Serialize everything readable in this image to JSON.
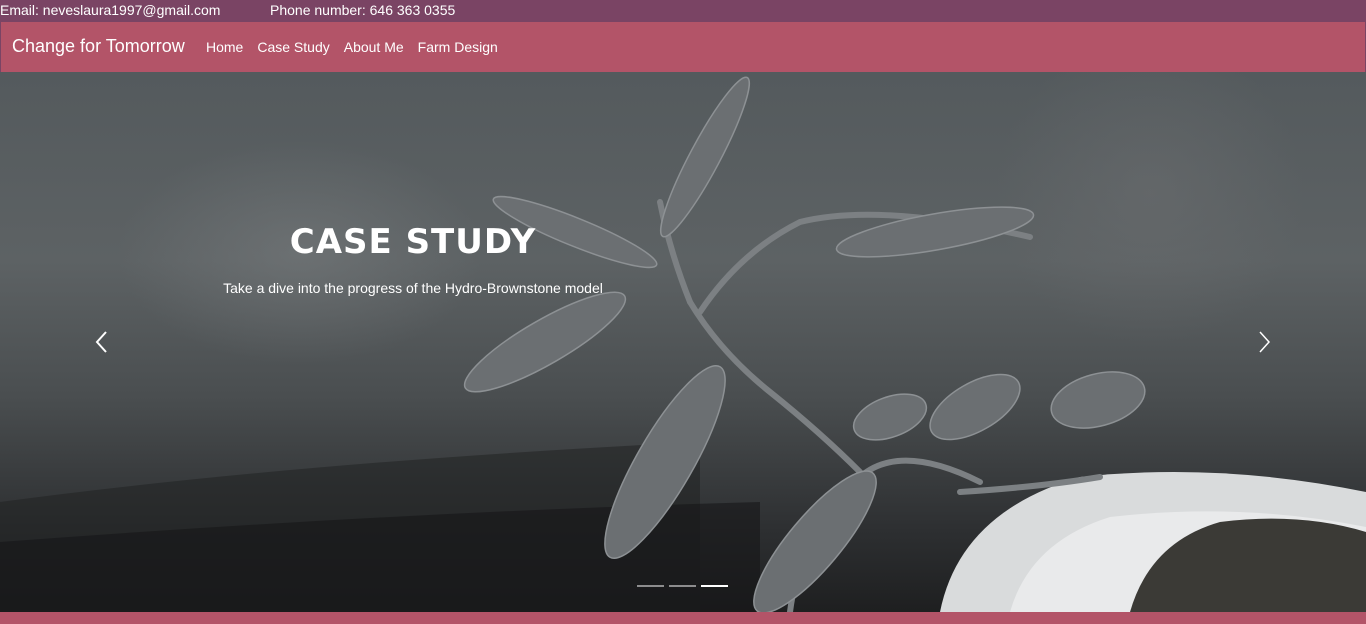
{
  "topbar": {
    "email": "Email: neveslaura1997@gmail.com",
    "phone": "Phone number: 646 363 0355"
  },
  "navbar": {
    "brand": "Change for Tomorrow",
    "links": [
      "Home",
      "Case Study",
      "About Me",
      "Farm Design"
    ]
  },
  "hero": {
    "title": "CASE STUDY",
    "subtitle": "Take a dive into the progress of the Hydro-Brownstone model",
    "image": "seedling-photo",
    "prev_icon": "chevron-left-icon",
    "next_icon": "chevron-right-icon",
    "slide_count": 3,
    "active_slide": 3
  },
  "colors": {
    "topbar": "#7a4464",
    "navbar": "#b35468",
    "text": "#ffffff"
  }
}
